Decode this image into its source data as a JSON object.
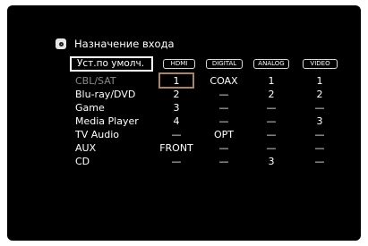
{
  "title": "Назначение входа",
  "default_button": "Уст.по умолч.",
  "columns": [
    "HDMI",
    "DIGITAL",
    "ANALOG",
    "VIDEO"
  ],
  "rows": [
    {
      "label": "CBL/SAT",
      "values": [
        "1",
        "COAX",
        "1",
        "1"
      ]
    },
    {
      "label": "Blu-ray/DVD",
      "values": [
        "2",
        "—",
        "2",
        "2"
      ]
    },
    {
      "label": "Game",
      "values": [
        "3",
        "—",
        "—",
        "—"
      ]
    },
    {
      "label": "Media Player",
      "values": [
        "4",
        "—",
        "—",
        "3"
      ]
    },
    {
      "label": "TV Audio",
      "values": [
        "—",
        "OPT",
        "—",
        "—"
      ]
    },
    {
      "label": "AUX",
      "values": [
        "FRONT",
        "—",
        "—",
        "—"
      ]
    },
    {
      "label": "CD",
      "values": [
        "—",
        "—",
        "3",
        "—"
      ]
    }
  ],
  "selected_row": "CBL/SAT",
  "selected_column": "HDMI",
  "colors": {
    "background": "#000000",
    "text": "#ffffff",
    "dim_text": "#8a8a8a",
    "cursor": "#a6866b"
  }
}
